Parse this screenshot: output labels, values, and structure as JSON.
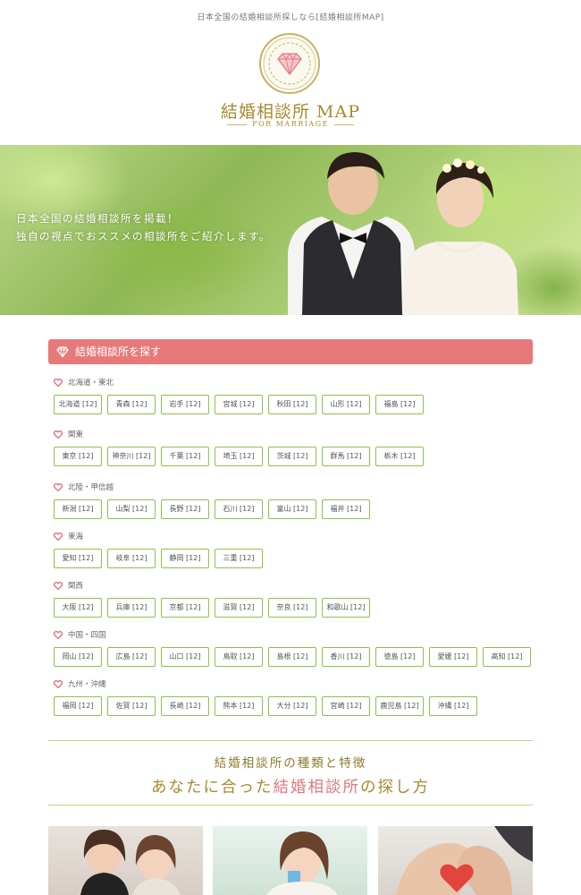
{
  "header": {
    "tagline": "日本全国の結婚相談所探しなら[結婚相談所MAP]",
    "site_title": "結婚相談所 MAP",
    "site_subtitle": "FOR MARRIAGE"
  },
  "hero": {
    "line1": "日本全国の結婚相談所を掲載！",
    "line2": "独自の視点でおススメの相談所をご紹介します。"
  },
  "search": {
    "heading": "結婚相談所を探す",
    "regions": [
      {
        "name": "北海道・東北",
        "prefs": [
          "北海道 [12]",
          "青森 [12]",
          "岩手 [12]",
          "宮城 [12]",
          "秋田 [12]",
          "山形 [12]",
          "福島 [12]"
        ]
      },
      {
        "name": "関東",
        "prefs": [
          "東京 [12]",
          "神奈川 [12]",
          "千葉 [12]",
          "埼玉 [12]",
          "茨城 [12]",
          "群馬 [12]",
          "栃木 [12]"
        ]
      },
      {
        "name": "北陸・甲信越",
        "prefs": [
          "新潟 [12]",
          "山梨 [12]",
          "長野 [12]",
          "石川 [12]",
          "富山 [12]",
          "福井 [12]"
        ]
      },
      {
        "name": "東海",
        "prefs": [
          "愛知 [12]",
          "岐阜 [12]",
          "静岡 [12]",
          "三重 [12]"
        ]
      },
      {
        "name": "関西",
        "prefs": [
          "大阪 [12]",
          "兵庫 [12]",
          "京都 [12]",
          "滋賀 [12]",
          "奈良 [12]",
          "和歌山 [12]"
        ]
      },
      {
        "name": "中国・四国",
        "prefs": [
          "岡山 [12]",
          "広島 [12]",
          "山口 [12]",
          "鳥取 [12]",
          "島根 [12]",
          "香川 [12]",
          "徳島 [12]",
          "愛媛 [12]",
          "高知 [12]"
        ]
      },
      {
        "name": "九州・沖縄",
        "prefs": [
          "福岡 [12]",
          "佐賀 [12]",
          "長崎 [12]",
          "熊本 [12]",
          "大分 [12]",
          "宮崎 [12]",
          "鹿児島 [12]",
          "沖縄 [12]"
        ]
      }
    ]
  },
  "features": {
    "subtitle": "結婚相談所の種類と特徴",
    "title_pre": "あなたに合った",
    "title_highlight": "結婚相談所",
    "title_post": "の探し方"
  },
  "colors": {
    "accent_gold": "#a8892f",
    "accent_pink": "#e8797a",
    "button_border": "#8bc34a"
  }
}
